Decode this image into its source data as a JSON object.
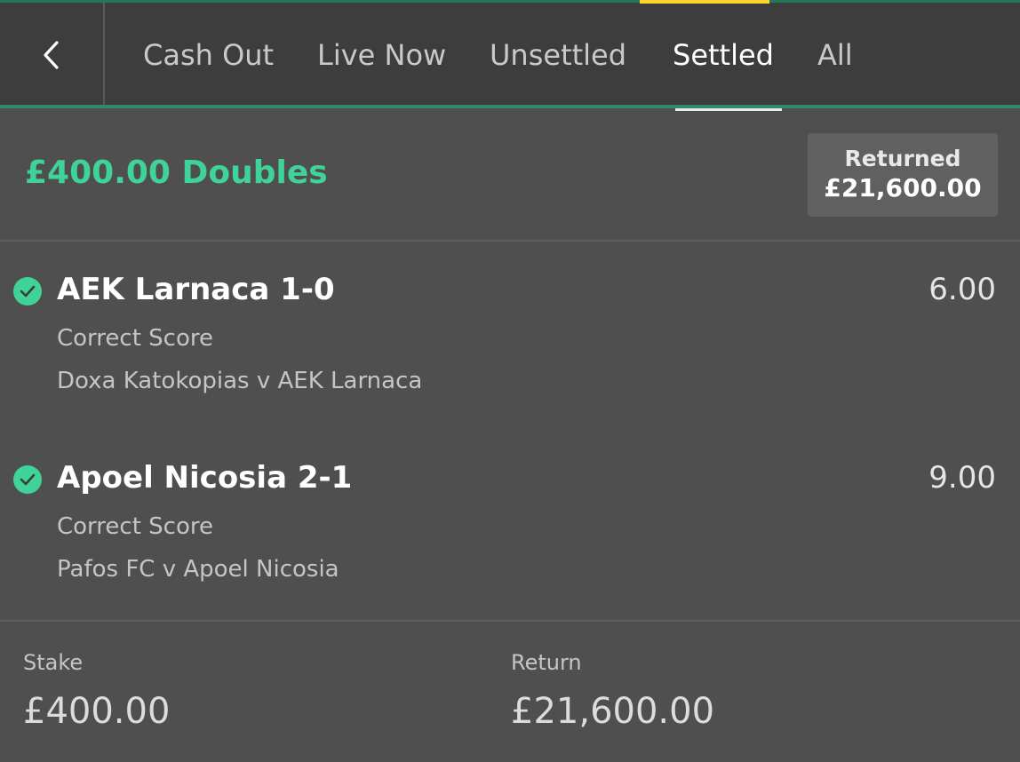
{
  "nav": {
    "back_icon": "chevron-left-icon",
    "tabs": [
      {
        "label": "Cash Out"
      },
      {
        "label": "Live Now"
      },
      {
        "label": "Unsettled"
      },
      {
        "label": "Settled"
      },
      {
        "label": "All"
      }
    ],
    "active_tab": "Settled"
  },
  "bet": {
    "title": "£400.00 Doubles",
    "returned_label": "Returned",
    "returned_amount": "£21,600.00",
    "selections": [
      {
        "name": "AEK Larnaca 1-0",
        "odds": "6.00",
        "market": "Correct Score",
        "event": "Doxa Katokopias v AEK Larnaca",
        "status_icon": "check-circle-icon"
      },
      {
        "name": "Apoel Nicosia 2-1",
        "odds": "9.00",
        "market": "Correct Score",
        "event": "Pafos FC v Apoel Nicosia",
        "status_icon": "check-circle-icon"
      }
    ],
    "stake_label": "Stake",
    "stake_value": "£400.00",
    "return_label": "Return",
    "return_value": "£21,600.00"
  },
  "colors": {
    "accent_green": "#3fd39a",
    "top_bar": "#3d3d3d",
    "background": "#4f4f4f",
    "highlight_yellow": "#ffd52e"
  }
}
